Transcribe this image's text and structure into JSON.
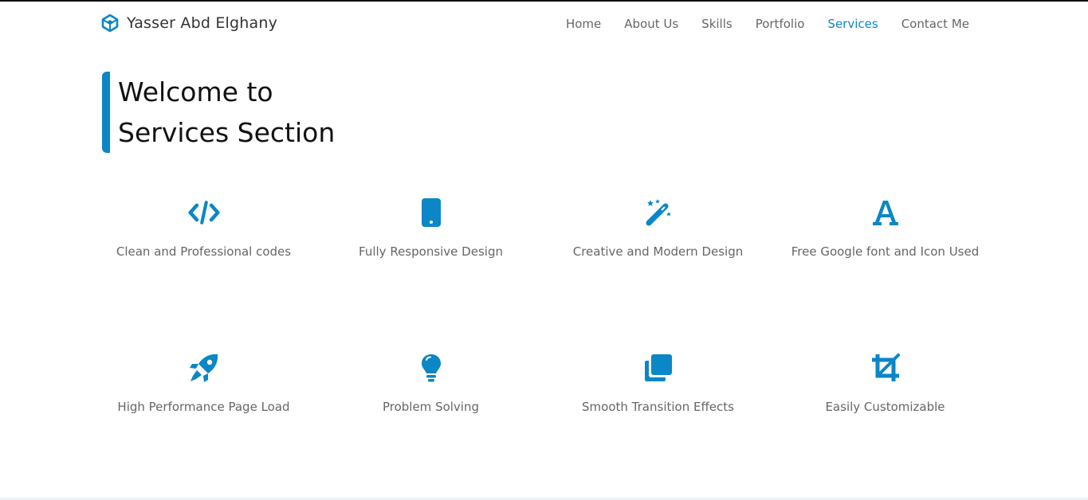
{
  "brand": {
    "name": "Yasser Abd Elghany",
    "icon": "codepen-icon"
  },
  "nav": {
    "items": [
      {
        "label": "Home",
        "active": false
      },
      {
        "label": "About Us",
        "active": false
      },
      {
        "label": "Skills",
        "active": false
      },
      {
        "label": "Portfolio",
        "active": false
      },
      {
        "label": "Services",
        "active": true
      },
      {
        "label": "Contact Me",
        "active": false
      }
    ]
  },
  "heading": {
    "line1": "Welcome to",
    "line2": "Services Section"
  },
  "services": [
    {
      "label": "Clean and Professional codes",
      "icon": "code-icon"
    },
    {
      "label": "Fully Responsive Design",
      "icon": "mobile-icon"
    },
    {
      "label": "Creative and Modern Design",
      "icon": "magic-wand-icon"
    },
    {
      "label": "Free Google font and Icon Used",
      "icon": "font-icon"
    },
    {
      "label": "High Performance Page Load",
      "icon": "rocket-icon"
    },
    {
      "label": "Problem Solving",
      "icon": "lightbulb-icon"
    },
    {
      "label": "Smooth Transition Effects",
      "icon": "clone-icon"
    },
    {
      "label": "Easily Customizable",
      "icon": "crop-icon"
    }
  ],
  "colors": {
    "accent": "#0b86c6",
    "heading": "#111111",
    "text": "#666666"
  }
}
